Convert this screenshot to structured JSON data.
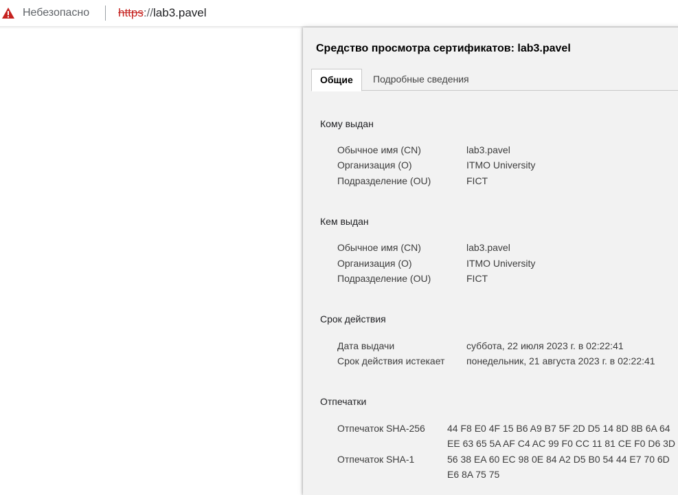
{
  "browser": {
    "insecure_label": "Небезопасно",
    "url_scheme": "https",
    "url_slashes": "://",
    "url_host": "lab3.pavel",
    "warning_color": "#c5221f"
  },
  "dialog": {
    "title": "Средство просмотра сертификатов: lab3.pavel",
    "tabs": [
      {
        "label": "Общие",
        "active": true
      },
      {
        "label": "Подробные сведения",
        "active": false
      }
    ],
    "issued_to": {
      "heading": "Кому выдан",
      "rows": [
        {
          "label": "Обычное имя (CN)",
          "value": "lab3.pavel"
        },
        {
          "label": "Организация (O)",
          "value": "ITMO University"
        },
        {
          "label": "Подразделение (OU)",
          "value": "FICT"
        }
      ]
    },
    "issued_by": {
      "heading": "Кем выдан",
      "rows": [
        {
          "label": "Обычное имя (CN)",
          "value": "lab3.pavel"
        },
        {
          "label": "Организация (O)",
          "value": "ITMO University"
        },
        {
          "label": "Подразделение (OU)",
          "value": "FICT"
        }
      ]
    },
    "validity": {
      "heading": "Срок действия",
      "rows": [
        {
          "label": "Дата выдачи",
          "value": "суббота, 22 июля 2023 г. в 02:22:41"
        },
        {
          "label": "Срок действия истекает",
          "value": "понедельник, 21 августа 2023 г. в 02:22:41"
        }
      ]
    },
    "fingerprints": {
      "heading": "Отпечатки",
      "sha256": {
        "label": "Отпечаток SHA-256",
        "line1": "44 F8 E0 4F 15 B6 A9 B7 5F 2D D5 14 8D 8B 6A 64",
        "line2": "EE 63 65 5A AF C4 AC 99 F0 CC 11 81 CE F0 D6 3D"
      },
      "sha1": {
        "label": "Отпечаток SHA-1",
        "line1": "56 38 EA 60 EC 98 0E 84 A2 D5 B0 54 44 E7 70 6D",
        "line2": "E6 8A 75 75"
      }
    }
  }
}
